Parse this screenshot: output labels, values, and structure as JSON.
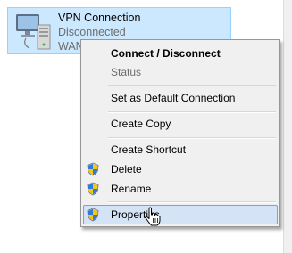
{
  "connection": {
    "name": "VPN Connection",
    "status": "Disconnected",
    "device": "WAN"
  },
  "menu": {
    "items": [
      {
        "label": "Connect / Disconnect",
        "style": "default"
      },
      {
        "label": "Status",
        "style": "disabled"
      },
      {
        "label": "Set as Default Connection"
      },
      {
        "label": "Create Copy"
      },
      {
        "label": "Create Shortcut"
      },
      {
        "label": "Delete",
        "icon": "uac-shield-icon"
      },
      {
        "label": "Rename",
        "icon": "uac-shield-icon"
      },
      {
        "label": "Properties",
        "icon": "uac-shield-icon",
        "state": "hover"
      }
    ]
  },
  "colors": {
    "selection": "#cce8ff",
    "menu_background": "#f0f0f0",
    "hover": "#d5e3f6"
  }
}
